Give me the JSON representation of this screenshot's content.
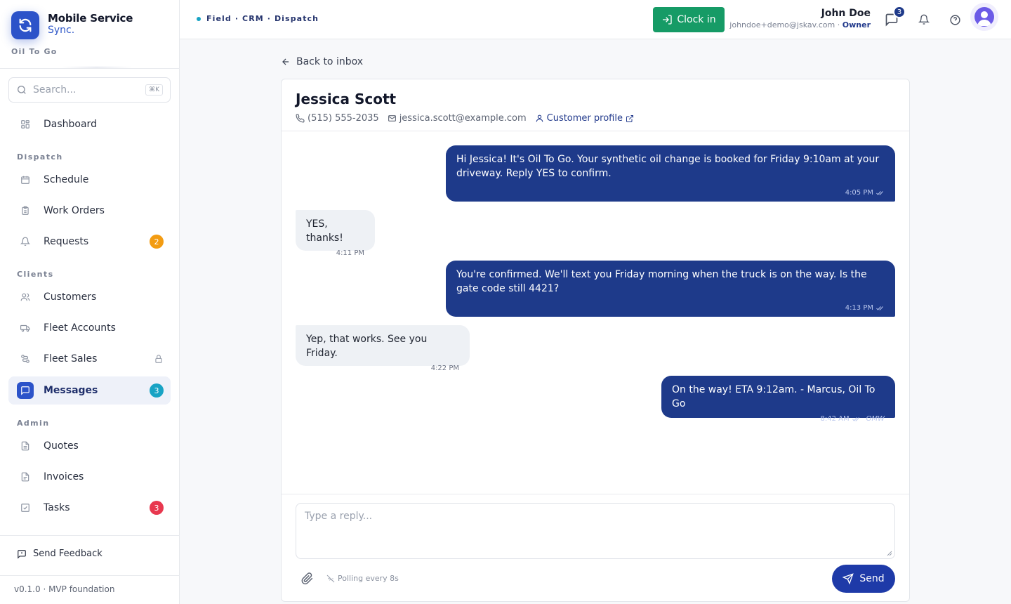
{
  "brand": {
    "name": "Mobile Service",
    "sub": "Sync.",
    "org": "Oil To Go"
  },
  "search": {
    "placeholder": "Search...",
    "shortcut": "⌘K"
  },
  "sidebar": {
    "dashboard": "Dashboard",
    "sections": {
      "dispatch": "Dispatch",
      "clients": "Clients",
      "admin": "Admin"
    },
    "items": {
      "schedule": "Schedule",
      "work_orders": "Work Orders",
      "requests": {
        "label": "Requests",
        "badge": "2"
      },
      "customers": "Customers",
      "fleet_accounts": "Fleet Accounts",
      "fleet_sales": "Fleet Sales",
      "messages": {
        "label": "Messages",
        "badge": "3"
      },
      "quotes": "Quotes",
      "invoices": "Invoices",
      "tasks": {
        "label": "Tasks",
        "badge": "3"
      }
    },
    "feedback": "Send Feedback",
    "version": "v0.1.0 · MVP foundation"
  },
  "topbar": {
    "breadcrumb": "Field · CRM · Dispatch",
    "clock_in": "Clock in",
    "user_name": "John Doe",
    "user_email": "johndoe+demo@jskav.com",
    "user_role": "Owner",
    "messages_count": "3"
  },
  "conversation": {
    "back": "Back to inbox",
    "contact_name": "Jessica Scott",
    "phone": "(515) 555-2035",
    "email": "jessica.scott@example.com",
    "profile_link": "Customer profile",
    "messages": [
      {
        "text": "Hi Jessica! It's Oil To Go. Your synthetic oil change is booked for Friday 9:10am at your driveway. Reply YES to confirm.",
        "time": "4:05 PM"
      },
      {
        "text": "YES, thanks!",
        "time": "4:11 PM"
      },
      {
        "text": "You're confirmed. We'll text you Friday morning when the truck is on the way. Is the gate code still 4421?",
        "time": "4:13 PM"
      },
      {
        "text": "Yep, that works. See you Friday.",
        "time": "4:22 PM"
      },
      {
        "text": "On the way! ETA 9:12am. - Marcus, Oil To Go",
        "time": "8:42 AM",
        "tag": "OMW"
      }
    ],
    "reply_placeholder": "Type a reply...",
    "polling": "Polling every 8s",
    "send": "Send"
  },
  "colors": {
    "primary": "#1e3a8a",
    "accent": "#2c53c9",
    "success": "#169b66",
    "warning": "#f39c12",
    "info": "#18a3c4",
    "danger": "#e8384f"
  }
}
